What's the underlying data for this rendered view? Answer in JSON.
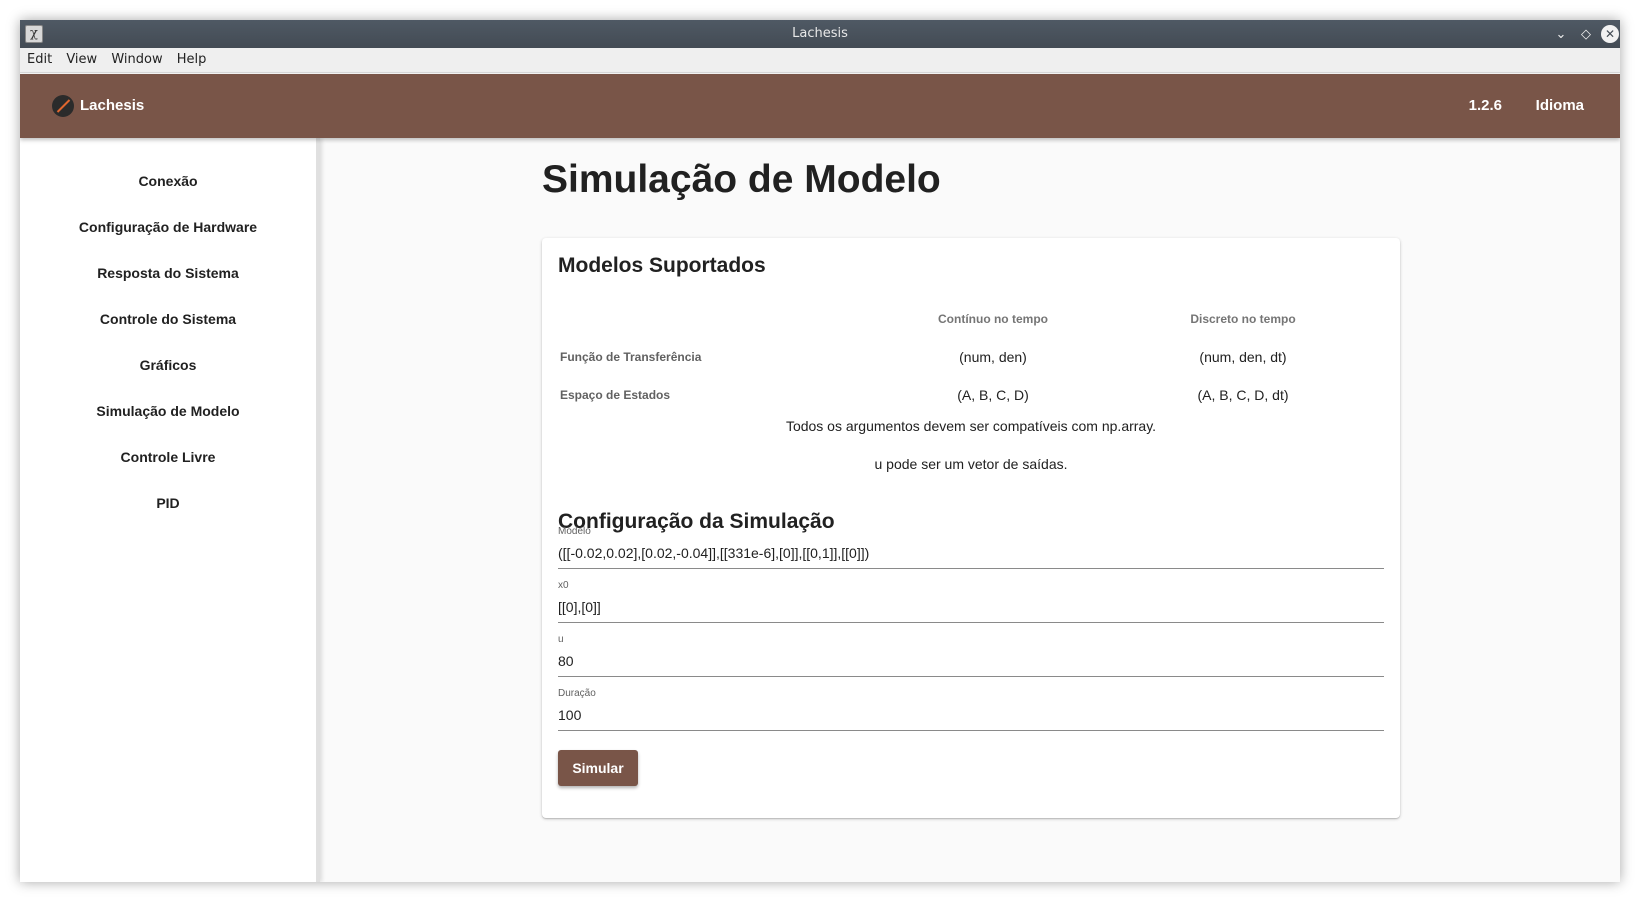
{
  "window": {
    "title": "Lachesis"
  },
  "menu": {
    "items": [
      "Edit",
      "View",
      "Window",
      "Help"
    ]
  },
  "appbar": {
    "brand": "Lachesis",
    "version": "1.2.6",
    "language": "Idioma"
  },
  "sidebar": {
    "items": [
      {
        "label": "Conexão"
      },
      {
        "label": "Configuração de Hardware"
      },
      {
        "label": "Resposta do Sistema"
      },
      {
        "label": "Controle do Sistema"
      },
      {
        "label": "Gráficos"
      },
      {
        "label": "Simulação de Modelo"
      },
      {
        "label": "Controle Livre"
      },
      {
        "label": "PID"
      }
    ]
  },
  "page": {
    "title": "Simulação de Modelo"
  },
  "models": {
    "heading": "Modelos Suportados",
    "columns": [
      "",
      "Contínuo no tempo",
      "Discreto no tempo"
    ],
    "rows": [
      {
        "name": "Função de Transferência",
        "continuous": "(num, den)",
        "discrete": "(num, den, dt)"
      },
      {
        "name": "Espaço de Estados",
        "continuous": "(A, B, C, D)",
        "discrete": "(A, B, C, D, dt)"
      }
    ],
    "notes": [
      "Todos os argumentos devem ser compatíveis com np.array.",
      "u pode ser um vetor de saídas."
    ]
  },
  "config": {
    "heading": "Configuração da Simulação",
    "fields": [
      {
        "label": "Modelo",
        "value": "([[-0.02,0.02],[0.02,-0.04]],[[331e-6],[0]],[[0,1]],[[0]])"
      },
      {
        "label": "x0",
        "value": "[[0],[0]]"
      },
      {
        "label": "u",
        "value": "80"
      },
      {
        "label": "Duração",
        "value": "100"
      }
    ],
    "button": "Simular"
  },
  "colors": {
    "primary": "#795548",
    "titlebar": "#4a535c"
  }
}
